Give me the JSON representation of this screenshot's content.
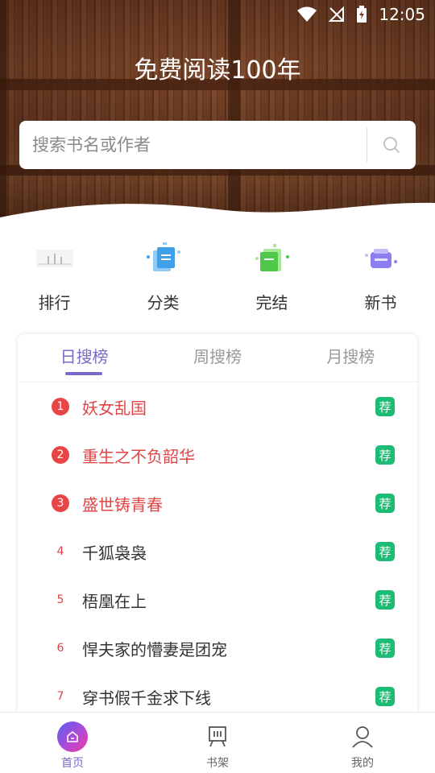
{
  "status_bar": {
    "time": "12:05"
  },
  "header": {
    "title": "免费阅读100年"
  },
  "search": {
    "placeholder": "搜索书名或作者"
  },
  "quick_nav": [
    {
      "label": "排行",
      "icon": "ranking-icon"
    },
    {
      "label": "分类",
      "icon": "category-icon"
    },
    {
      "label": "完结",
      "icon": "completed-icon"
    },
    {
      "label": "新书",
      "icon": "new-book-icon"
    }
  ],
  "rank_tabs": [
    {
      "label": "日搜榜",
      "active": true
    },
    {
      "label": "周搜榜",
      "active": false
    },
    {
      "label": "月搜榜",
      "active": false
    }
  ],
  "rank_list": [
    {
      "rank": "1",
      "title": "妖女乱国",
      "badge": "荐"
    },
    {
      "rank": "2",
      "title": "重生之不负韶华",
      "badge": "荐"
    },
    {
      "rank": "3",
      "title": "盛世铸青春",
      "badge": "荐"
    },
    {
      "rank": "4",
      "title": "千狐袅袅",
      "badge": "荐"
    },
    {
      "rank": "5",
      "title": "梧凰在上",
      "badge": "荐"
    },
    {
      "rank": "6",
      "title": "悍夫家的懵妻是团宠",
      "badge": "荐"
    },
    {
      "rank": "7",
      "title": "穿书假千金求下线",
      "badge": "荐"
    }
  ],
  "bottom_nav": [
    {
      "label": "首页",
      "icon": "home-icon",
      "active": true
    },
    {
      "label": "书架",
      "icon": "bookshelf-icon",
      "active": false
    },
    {
      "label": "我的",
      "icon": "profile-icon",
      "active": false
    }
  ],
  "colors": {
    "accent": "#7b68c8",
    "top_rank": "#e84545",
    "badge": "#1dbc74"
  }
}
